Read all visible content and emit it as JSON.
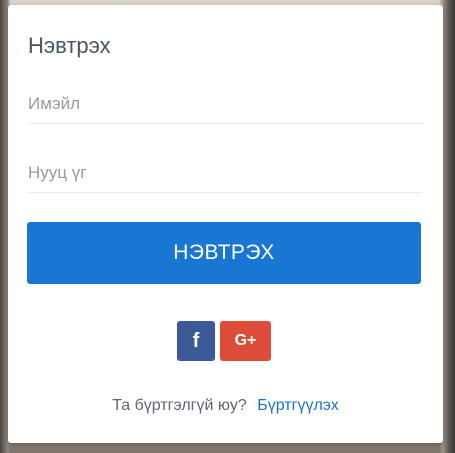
{
  "login_card": {
    "title": "Нэвтрэх",
    "email_placeholder": "Имэйл",
    "password_placeholder": "Нууц үг",
    "submit_label": "НЭВТРЭХ",
    "social": {
      "facebook_label": "f",
      "google_label": "G+"
    },
    "footer": {
      "question": "Та бүртгэлгүй юу?",
      "register_link": "Бүртгүүлэх"
    }
  },
  "colors": {
    "primary": "#1976d2",
    "facebook": "#3b5998",
    "google": "#dd4b39",
    "link": "#1a73c7"
  },
  "icons": {
    "facebook": "facebook-icon",
    "google": "google-plus-icon"
  }
}
